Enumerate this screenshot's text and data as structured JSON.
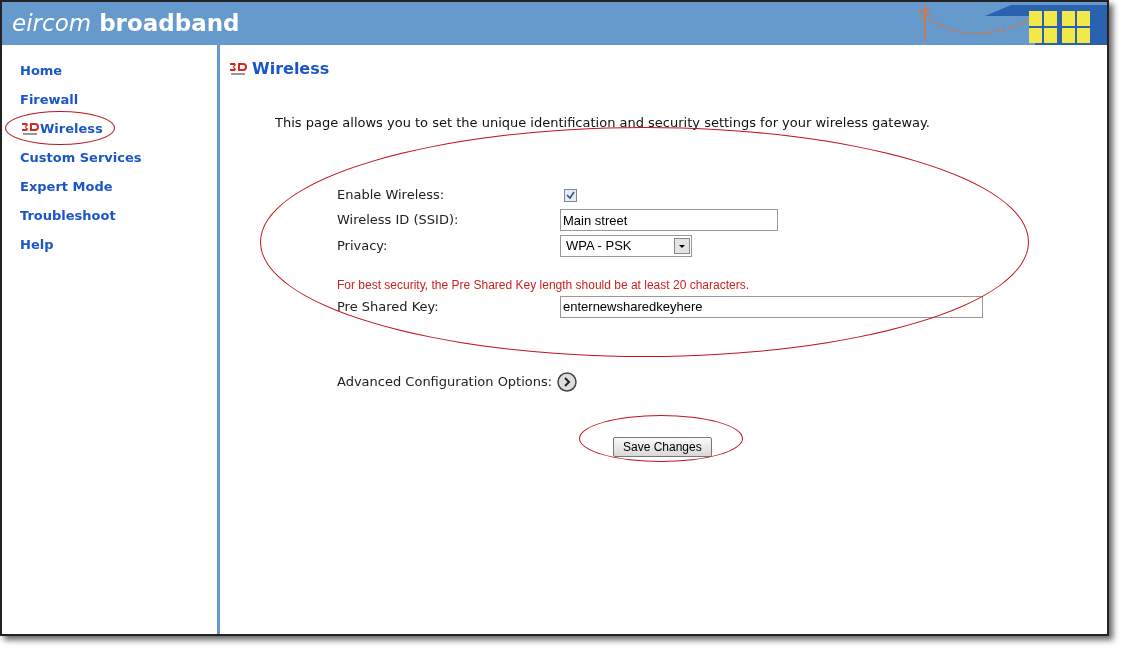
{
  "header": {
    "brand_light": "eircom",
    "brand_bold": "broadband"
  },
  "sidebar": {
    "items": [
      {
        "label": "Home",
        "selected": false
      },
      {
        "label": "Firewall",
        "selected": false
      },
      {
        "label": "Wireless",
        "selected": true
      },
      {
        "label": "Custom Services",
        "selected": false
      },
      {
        "label": "Expert Mode",
        "selected": false
      },
      {
        "label": "Troubleshoot",
        "selected": false
      },
      {
        "label": "Help",
        "selected": false
      }
    ]
  },
  "page": {
    "title": "Wireless",
    "intro": "This page allows you to set the unique identification and security settings for your wireless gateway.",
    "enable_wireless": {
      "label": "Enable Wireless:",
      "checked": true
    },
    "ssid": {
      "label": "Wireless ID (SSID):",
      "value": "Main street"
    },
    "privacy": {
      "label": "Privacy:",
      "value": "WPA - PSK"
    },
    "warning": "For best security, the Pre Shared Key length should be at least 20 characters.",
    "psk": {
      "label": "Pre Shared Key:",
      "value": "enternewsharedkeyhere"
    },
    "advanced": {
      "label": "Advanced Configuration Options:"
    },
    "save_button": "Save Changes"
  }
}
